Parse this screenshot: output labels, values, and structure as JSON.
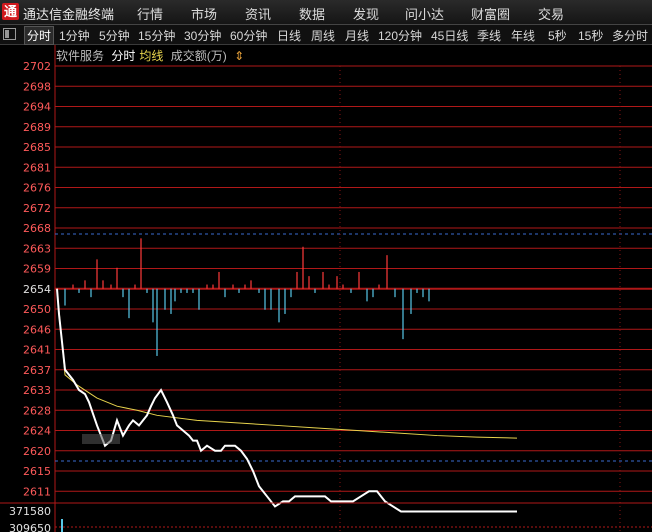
{
  "app": {
    "title": "通达信金融终端",
    "logo": "通"
  },
  "menu": [
    "行情",
    "市场",
    "资讯",
    "数据",
    "发现",
    "问小达",
    "财富圈",
    "交易"
  ],
  "tabs": [
    "分时",
    "1分钟",
    "5分钟",
    "15分钟",
    "30分钟",
    "60分钟",
    "日线",
    "周线",
    "月线",
    "120分钟",
    "45日线",
    "季线",
    "年线",
    "5秒",
    "15秒",
    "多分时"
  ],
  "active_tab": "分时",
  "info": {
    "software": "软件服务",
    "period": "分时",
    "avg_line": "均线",
    "volume": "成交额(万)",
    "arrow": "⇕"
  },
  "colors": {
    "up": "#ff3b3b",
    "down": "#58c8e8",
    "price": "#ffffff",
    "avg": "#e8d44d",
    "grid": "#b01818"
  },
  "chart_data": {
    "type": "line",
    "y_ticks": [
      2702,
      2698,
      2694,
      2689,
      2685,
      2681,
      2676,
      2672,
      2668,
      2663,
      2659,
      2654,
      2650,
      2646,
      2641,
      2637,
      2633,
      2628,
      2624,
      2620,
      2615,
      2611
    ],
    "prev_close": 2654,
    "ylim": [
      2609,
      2704
    ],
    "volume_labels": [
      "371580",
      "309650"
    ],
    "x": [
      0,
      2,
      8,
      16,
      22,
      28,
      32,
      40,
      44,
      48,
      54,
      60,
      66,
      72,
      76,
      82,
      86,
      90,
      94,
      98,
      104,
      110,
      116,
      120,
      126,
      132,
      136,
      140,
      144,
      150,
      158,
      164,
      168,
      172,
      178,
      184,
      190,
      196,
      202,
      210,
      218,
      226,
      232,
      238,
      244,
      250,
      256,
      262,
      268,
      274,
      278,
      284,
      290,
      296,
      304,
      312,
      320,
      328,
      336,
      344,
      352,
      360,
      368,
      376,
      384,
      392,
      400,
      408,
      414,
      420,
      428,
      436,
      444,
      452,
      460
    ],
    "price": [
      2654,
      2649,
      2637,
      2635,
      2633,
      2632,
      2630,
      2625,
      2623,
      2621,
      2622,
      2626,
      2623,
      2625,
      2626,
      2625,
      2626,
      2627,
      2629,
      2631,
      2633,
      2630,
      2627,
      2625,
      2624,
      2623,
      2622,
      2622,
      2620,
      2621,
      2620,
      2620,
      2621,
      2621,
      2621,
      2620,
      2618,
      2615,
      2612,
      2610,
      2608,
      2609,
      2609,
      2610,
      2610,
      2610,
      2610,
      2610,
      2610,
      2609,
      2609,
      2609,
      2609,
      2609,
      2610,
      2611,
      2611,
      2609,
      2608,
      2607,
      2607,
      2607,
      2607,
      2607,
      2607,
      2607,
      2607,
      2607,
      2607,
      2607,
      2607,
      2607,
      2607,
      2607,
      2607
    ],
    "avg_x": [
      0,
      8,
      20,
      40,
      60,
      80,
      100,
      140,
      180,
      220,
      260,
      300,
      340,
      380,
      420,
      460
    ],
    "avg": [
      2654,
      2636,
      2634,
      2631,
      2629,
      2628,
      2627,
      2626,
      2625.5,
      2625,
      2624.5,
      2624,
      2623.5,
      2623,
      2622.7,
      2622.5
    ],
    "ticks_x": [
      8,
      16,
      22,
      28,
      34,
      40,
      46,
      54,
      60,
      66,
      72,
      78,
      84,
      90,
      96,
      100,
      108,
      114,
      118,
      124,
      130,
      136,
      142,
      150,
      156,
      162,
      168,
      176,
      182,
      188,
      194,
      202,
      208,
      214,
      222,
      228,
      234,
      240,
      246,
      252,
      258,
      266,
      272,
      280,
      286,
      294,
      302,
      310,
      316,
      322,
      330,
      338,
      346,
      354,
      360,
      366,
      372,
      378,
      386,
      392,
      398,
      404,
      410,
      416,
      422,
      428,
      434,
      440,
      446,
      452,
      458
    ],
    "ticks_v": [
      -4,
      1,
      -1,
      2,
      -2,
      7,
      2,
      1,
      5,
      -2,
      -7,
      1,
      12,
      -1,
      -8,
      -16,
      -5,
      -6,
      -3,
      -1,
      -1,
      -1,
      -5,
      1,
      1,
      4,
      -2,
      1,
      -1,
      1,
      2,
      -1,
      -5,
      -5,
      -8,
      -6,
      -2,
      4,
      10,
      3,
      -1,
      4,
      1,
      3,
      1,
      -1,
      4,
      -3,
      -2,
      1,
      8,
      -2,
      -12,
      -6,
      -1,
      -2,
      -3
    ],
    "volume_tick_x": 62
  }
}
